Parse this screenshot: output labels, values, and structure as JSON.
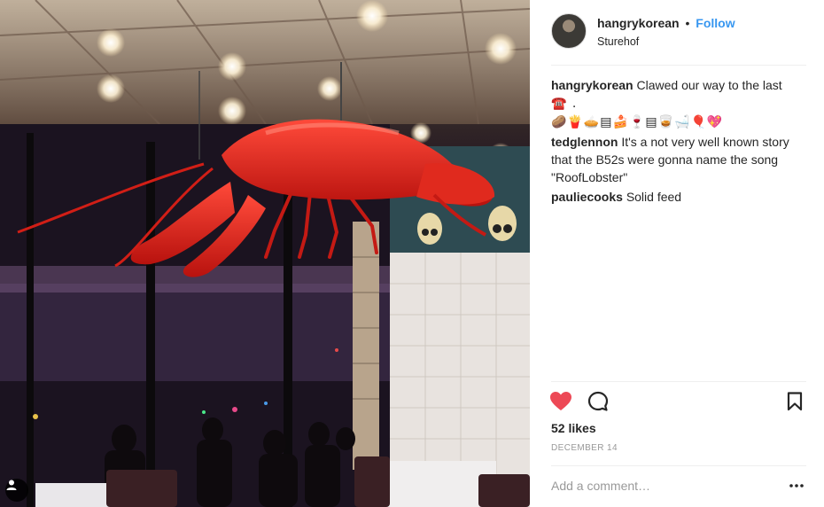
{
  "post": {
    "username": "hangrykorean",
    "separator": "•",
    "follow_label": "Follow",
    "location": "Sturehof"
  },
  "comments": [
    {
      "user": "hangrykorean",
      "text": "Clawed our way to the last",
      "emoji_line1": "☎️ .",
      "emoji_line2": "🥔🍟🥧▤🍰🍷▤🥃🛁🎈💖"
    },
    {
      "user": "tedglennon",
      "text": "It's a not very well known story that the B52s were gonna name the song \"RoofLobster\""
    },
    {
      "user": "pauliecooks",
      "text": "Solid feed"
    }
  ],
  "actions": {
    "like_icon": "heart-filled-icon",
    "comment_icon": "comment-icon",
    "save_icon": "bookmark-icon",
    "like_color": "#ed4956"
  },
  "likes": "52 likes",
  "date": "DECEMBER 14",
  "add_comment": {
    "placeholder": "Add a comment…",
    "more_icon": "ellipsis-icon"
  },
  "photo": {
    "description_icon": "user-tag-icon"
  }
}
